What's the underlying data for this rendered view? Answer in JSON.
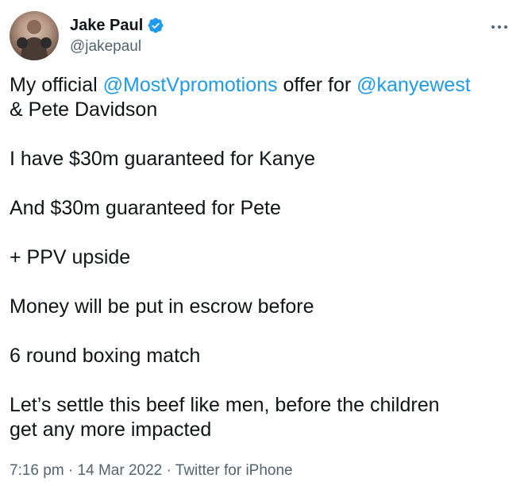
{
  "author": {
    "display_name": "Jake Paul",
    "handle": "@jakepaul",
    "verified": true,
    "avatar_icon": "user-avatar",
    "verified_icon": "verified-badge-icon",
    "verified_color": "#1d9bf0"
  },
  "more_menu": {
    "icon": "more-horizontal-icon"
  },
  "tweet": {
    "line1_prefix": "My official ",
    "mention_mostv": "@MostVpromotions",
    "line1_mid": " offer for ",
    "mention_kanye": "@kanyewest",
    "line2": "& Pete Davidson",
    "p2": "I have $30m guaranteed for Kanye",
    "p3": "And $30m guaranteed for Pete",
    "p4": "+ PPV upside",
    "p5": "Money will be put in escrow before",
    "p6": "6 round boxing match",
    "p7_line1": "Let’s settle this beef like men, before the children",
    "p7_line2": "get any more impacted"
  },
  "meta": {
    "time": "7:16 pm",
    "sep1": " · ",
    "date": "14 Mar 2022",
    "sep2": " · ",
    "source": "Twitter for iPhone"
  },
  "colors": {
    "text": "#0f1419",
    "secondary": "#536471",
    "link": "#1d9bf0"
  }
}
